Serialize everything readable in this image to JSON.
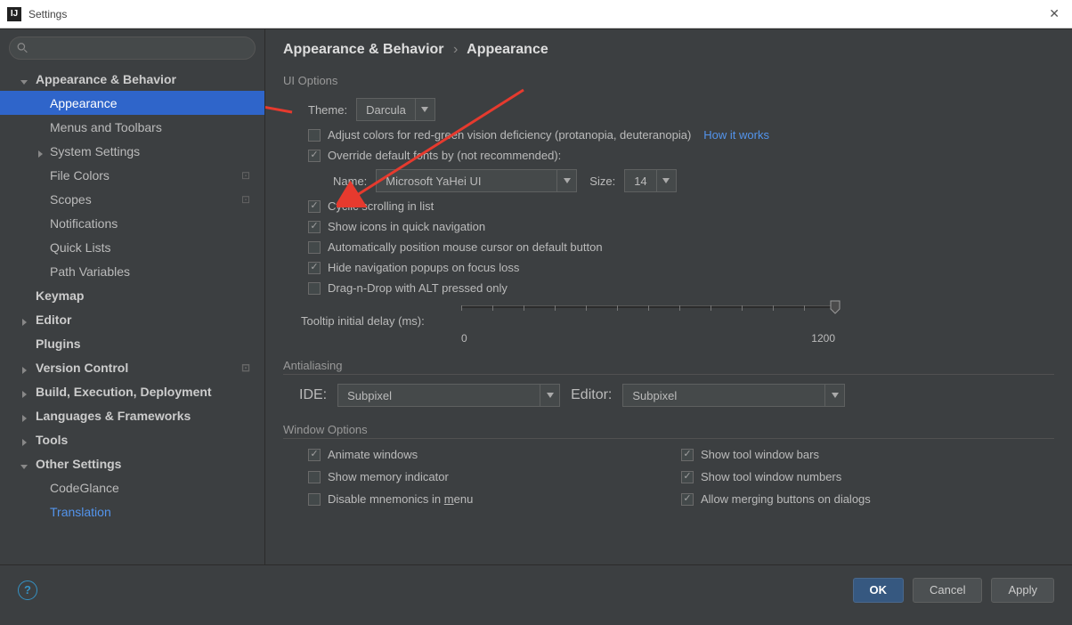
{
  "window": {
    "title": "Settings"
  },
  "breadcrumb": {
    "group": "Appearance & Behavior",
    "page": "Appearance"
  },
  "sidebar": {
    "items": [
      {
        "label": "Appearance & Behavior",
        "type": "group",
        "expanded": true
      },
      {
        "label": "Appearance",
        "type": "item",
        "selected": true
      },
      {
        "label": "Menus and Toolbars",
        "type": "item"
      },
      {
        "label": "System Settings",
        "type": "group",
        "expanded": false
      },
      {
        "label": "File Colors",
        "type": "item",
        "tag": "⊡"
      },
      {
        "label": "Scopes",
        "type": "item",
        "tag": "⊡"
      },
      {
        "label": "Notifications",
        "type": "item"
      },
      {
        "label": "Quick Lists",
        "type": "item"
      },
      {
        "label": "Path Variables",
        "type": "item"
      },
      {
        "label": "Keymap",
        "type": "top"
      },
      {
        "label": "Editor",
        "type": "top-group",
        "expanded": false
      },
      {
        "label": "Plugins",
        "type": "top"
      },
      {
        "label": "Version Control",
        "type": "top-group",
        "expanded": false,
        "tag": "⊡"
      },
      {
        "label": "Build, Execution, Deployment",
        "type": "top-group",
        "expanded": false
      },
      {
        "label": "Languages & Frameworks",
        "type": "top-group",
        "expanded": false
      },
      {
        "label": "Tools",
        "type": "top-group",
        "expanded": false
      },
      {
        "label": "Other Settings",
        "type": "top-group",
        "expanded": true
      },
      {
        "label": "CodeGlance",
        "type": "item"
      },
      {
        "label": "Translation",
        "type": "item",
        "link": true
      }
    ]
  },
  "ui_options": {
    "section_label": "UI Options",
    "theme_label": "Theme:",
    "theme_value": "Darcula",
    "adjust_colors_label": "Adjust colors for red-green vision deficiency (protanopia, deuteranopia)",
    "adjust_colors_checked": false,
    "how_it_works": "How it works",
    "override_fonts_label": "Override default fonts by (not recommended):",
    "override_fonts_checked": true,
    "name_label": "Name:",
    "name_value": "Microsoft YaHei UI",
    "size_label": "Size:",
    "size_value": "14",
    "cyclic_label": "Cyclic scrolling in list",
    "cyclic_checked": true,
    "show_icons_label": "Show icons in quick navigation",
    "show_icons_checked": true,
    "auto_mouse_label": "Automatically position mouse cursor on default button",
    "auto_mouse_checked": false,
    "hide_popups_label": "Hide navigation popups on focus loss",
    "hide_popups_checked": true,
    "dnd_alt_label": "Drag-n-Drop with ALT pressed only",
    "dnd_alt_checked": false,
    "tooltip_label": "Tooltip initial delay (ms):",
    "tooltip_min": "0",
    "tooltip_max": "1200",
    "tooltip_value": 1200
  },
  "antialiasing": {
    "section_label": "Antialiasing",
    "ide_label": "IDE:",
    "ide_value": "Subpixel",
    "editor_label": "Editor:",
    "editor_value": "Subpixel"
  },
  "window_options": {
    "section_label": "Window Options",
    "animate_label": "Animate windows",
    "animate_checked": true,
    "memory_label": "Show memory indicator",
    "memory_checked": false,
    "mnemonics_label_pre": "Disable mnemonics in ",
    "mnemonics_label_u": "m",
    "mnemonics_label_post": "enu",
    "mnemonics_checked": false,
    "tool_bars_label": "Show tool window bars",
    "tool_bars_checked": true,
    "tool_numbers_label": "Show tool window numbers",
    "tool_numbers_checked": true,
    "merge_buttons_label": "Allow merging buttons on dialogs",
    "merge_buttons_checked": true
  },
  "buttons": {
    "ok": "OK",
    "cancel": "Cancel",
    "apply": "Apply"
  }
}
